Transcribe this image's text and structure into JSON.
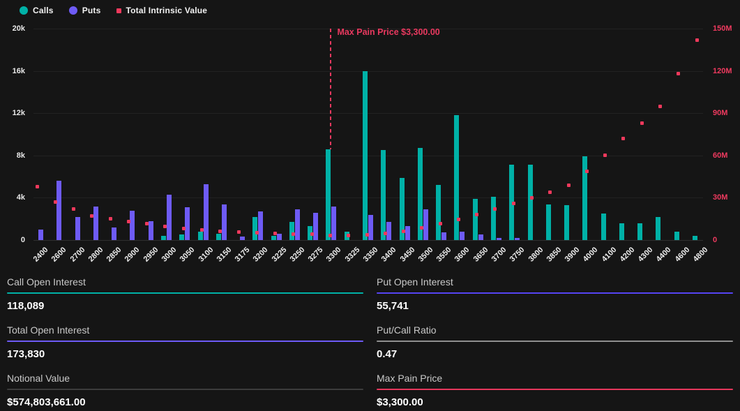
{
  "legend": {
    "items": [
      {
        "label": "Calls",
        "color": "#00b1a7",
        "marker": "circle"
      },
      {
        "label": "Puts",
        "color": "#6e5bf6",
        "marker": "circle"
      },
      {
        "label": "Total Intrinsic Value",
        "color": "#f0395c",
        "marker": "square"
      }
    ]
  },
  "chart_data": {
    "type": "bar+scatter",
    "title": "",
    "categories": [
      "2400",
      "2600",
      "2700",
      "2800",
      "2850",
      "2900",
      "2950",
      "3000",
      "3050",
      "3100",
      "3150",
      "3175",
      "3200",
      "3225",
      "3250",
      "3275",
      "3300",
      "3325",
      "3350",
      "3400",
      "3450",
      "3500",
      "3550",
      "3600",
      "3650",
      "3700",
      "3750",
      "3800",
      "3850",
      "3900",
      "4000",
      "4100",
      "4200",
      "4300",
      "4400",
      "4600",
      "4800"
    ],
    "series": [
      {
        "name": "Calls",
        "type": "bar",
        "axis": "left",
        "color": "#00b1a7",
        "values": [
          0,
          0,
          0,
          0,
          0,
          0,
          0,
          400,
          500,
          800,
          600,
          0,
          2200,
          400,
          1700,
          1300,
          8600,
          800,
          16000,
          8500,
          5900,
          8700,
          5200,
          11800,
          3900,
          4100,
          7100,
          7100,
          3400,
          3300,
          7900,
          2500,
          1600,
          1600,
          2200,
          800,
          400
        ]
      },
      {
        "name": "Puts",
        "type": "bar",
        "axis": "left",
        "color": "#6e5bf6",
        "values": [
          1000,
          5600,
          2200,
          3200,
          1200,
          2800,
          1800,
          4300,
          3100,
          5300,
          3400,
          300,
          2700,
          600,
          2900,
          2600,
          3200,
          0,
          2400,
          1700,
          1300,
          2900,
          700,
          800,
          500,
          200,
          200,
          0,
          0,
          0,
          0,
          0,
          0,
          0,
          0,
          0,
          0
        ]
      },
      {
        "name": "Total Intrinsic Value",
        "type": "scatter",
        "axis": "right",
        "color": "#f0395c",
        "unit": "M",
        "values": [
          38,
          27,
          22,
          17,
          15,
          13,
          11.5,
          9.5,
          8,
          7,
          6,
          5.5,
          5.2,
          4.8,
          4.4,
          4,
          3,
          3.2,
          3.6,
          4.5,
          6,
          8.5,
          11.5,
          14.5,
          18,
          22,
          26,
          30,
          34,
          39,
          49,
          60,
          72,
          83,
          95,
          118,
          142
        ]
      }
    ],
    "left_axis": {
      "max": 20000,
      "ticks": [
        "0",
        "4k",
        "8k",
        "12k",
        "16k",
        "20k"
      ],
      "color": "#e8e8e8"
    },
    "right_axis": {
      "max": 150,
      "ticks": [
        "0",
        "30M",
        "60M",
        "90M",
        "120M",
        "150M"
      ],
      "color": "#ef3a5f"
    },
    "max_pain": {
      "strike": "3300",
      "label": "Max Pain Price $3,300.00",
      "line_color": "#e9395f"
    },
    "grid": true,
    "legend_position": "top-left"
  },
  "stats": [
    {
      "label": "Call Open Interest",
      "value": "118,089",
      "underline_color": "#00b1a7"
    },
    {
      "label": "Put Open Interest",
      "value": "55,741",
      "underline_color": "#5544f2"
    },
    {
      "label": "Total Open Interest",
      "value": "173,830",
      "underline_color": "#6d5af5"
    },
    {
      "label": "Put/Call Ratio",
      "value": "0.47",
      "underline_color": "#8f8f8f"
    },
    {
      "label": "Notional Value",
      "value": "$574,803,661.00",
      "underline_color": "#3c3c3c"
    },
    {
      "label": "Max Pain Price",
      "value": "$3,300.00",
      "underline_color": "#e5375c"
    }
  ]
}
